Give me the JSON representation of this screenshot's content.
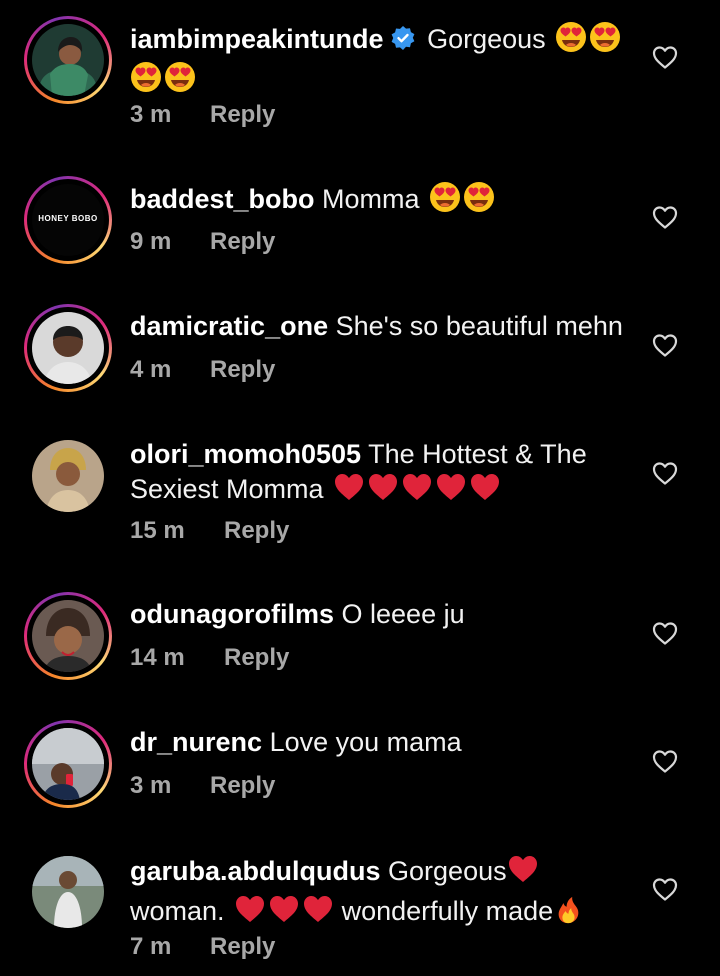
{
  "comments": [
    {
      "username": "iambimpeakintunde",
      "verified": true,
      "text_before": "Gorgeous",
      "time": "3 m",
      "reply_label": "Reply",
      "emojis": [
        "heart-eyes",
        "heart-eyes",
        "heart-eyes",
        "heart-eyes"
      ]
    },
    {
      "username": "baddest_bobo",
      "text": "Momma",
      "time": "9 m",
      "reply_label": "Reply",
      "avatar_text": "HONEY BOBO"
    },
    {
      "username": "damicratic_one",
      "text": "She's so beautiful mehn",
      "time": "4 m",
      "reply_label": "Reply"
    },
    {
      "username": "olori_momoh0505",
      "text_line1": "The Hottest & The",
      "text_line2": "Sexiest Momma",
      "time": "15 m",
      "reply_label": "Reply"
    },
    {
      "username": "odunagorofilms",
      "text": "O leeee ju",
      "time": "14 m",
      "reply_label": "Reply"
    },
    {
      "username": "dr_nurenc",
      "text": "Love you mama",
      "time": "3 m",
      "reply_label": "Reply"
    },
    {
      "username": "garuba.abdulqudus",
      "text_line1": "Gorgeous",
      "text_line2a": "woman.",
      "text_line2b": "wonderfully made",
      "time": "7 m",
      "reply_label": "Reply"
    }
  ],
  "icons": {
    "like": "heart-outline-icon",
    "verified": "verified-badge-icon",
    "emoji_heart_eyes": "heart-eyes-emoji",
    "emoji_red_heart": "red-heart-emoji",
    "emoji_fire": "fire-emoji"
  },
  "colors": {
    "background": "#000000",
    "text": "#f2f2f2",
    "meta": "#a8a8a8",
    "verified": "#3897f0",
    "heart_red": "#e0243a"
  }
}
